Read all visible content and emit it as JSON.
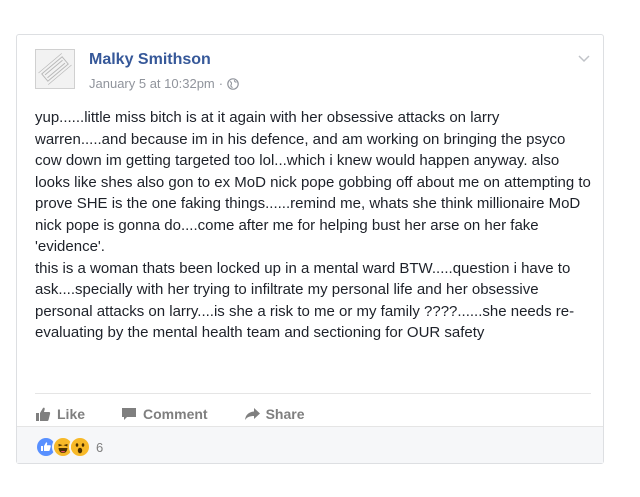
{
  "post": {
    "author": "Malky Smithson",
    "timestamp": "January 5 at 10:32pm",
    "separator": "·",
    "privacy_icon": "globe-icon",
    "menu_icon": "chevron-down-icon",
    "paragraphs": [
      "yup......little miss bitch is at it again with her obsessive attacks on larry warren.....and because im in his defence, and am working on bringing the psyco cow down im getting targeted too lol...which i knew would happen anyway. also looks like shes also gon to ex MoD nick pope gobbing off about me on attempting to prove SHE is the one faking things......remind me, whats she think millionaire MoD nick pope is gonna do....come after me for helping bust her arse on her fake 'evidence'.",
      "this is a woman thats been locked up in a mental ward BTW.....question i have to ask....specially with her trying to infiltrate my personal life and her obsessive personal attacks on larry....is she a risk to me or my family ????......she needs re-evaluating by the mental health team and sectioning for OUR safety"
    ]
  },
  "actions": {
    "like_label": "Like",
    "comment_label": "Comment",
    "share_label": "Share"
  },
  "reactions": {
    "icons": [
      "like-reaction-icon",
      "haha-reaction-icon",
      "wow-reaction-icon"
    ],
    "count": "6"
  },
  "colors": {
    "author_link": "#365899",
    "meta_gray": "#90949c",
    "like_blue": "#5890ff",
    "emoji_yellow": "#f7b928"
  }
}
